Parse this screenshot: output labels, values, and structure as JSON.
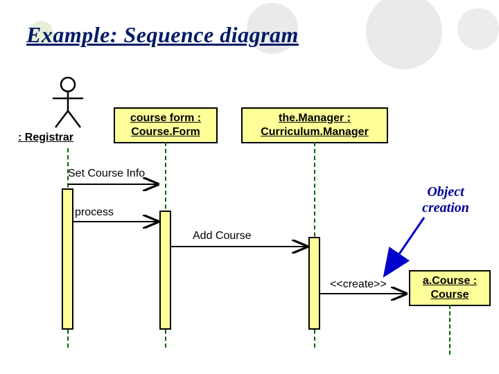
{
  "title": "Example: Sequence diagram",
  "actor": {
    "label": ": Registrar"
  },
  "objects": {
    "courseForm": {
      "line1": "course form :",
      "line2": "Course.Form"
    },
    "manager": {
      "line1": "the.Manager :",
      "line2": "Curriculum.Manager"
    },
    "course": {
      "line1": "a.Course :",
      "line2": "Course"
    }
  },
  "messages": {
    "setCourseInfo": "Set Course Info",
    "process": "process",
    "addCourse": "Add Course",
    "create": "<<create>>"
  },
  "note": {
    "line1": "Object",
    "line2": "creation"
  }
}
